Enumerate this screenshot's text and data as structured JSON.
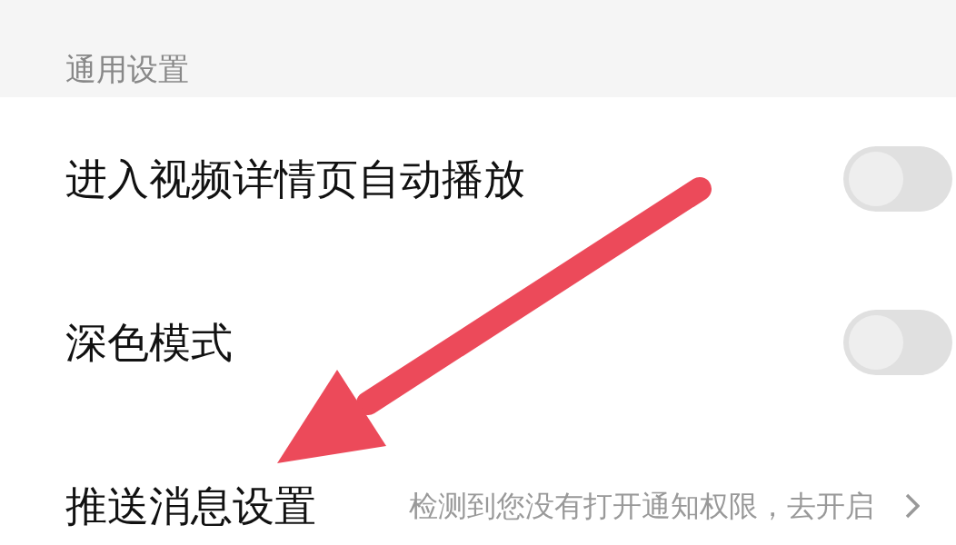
{
  "section": {
    "title": "通用设置"
  },
  "settings": [
    {
      "kind": "toggle",
      "label": "进入视频详情页自动播放",
      "on": false
    },
    {
      "kind": "toggle",
      "label": "深色模式",
      "on": false
    },
    {
      "kind": "link",
      "label": "推送消息设置",
      "hint": "检测到您没有打开通知权限，去开启"
    }
  ]
}
